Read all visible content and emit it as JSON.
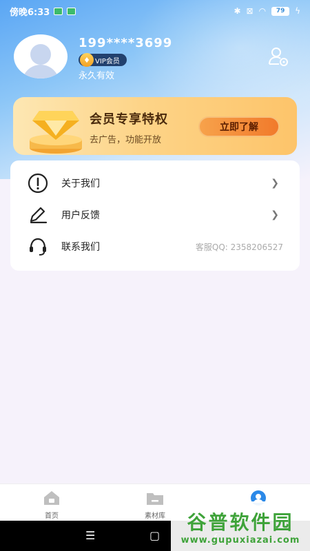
{
  "status_bar": {
    "time": "傍晚6:33",
    "battery": "79",
    "icons": [
      "bluetooth-icon",
      "sim-x-icon",
      "wifi-icon",
      "charging-icon"
    ]
  },
  "profile": {
    "phone": "199****3699",
    "vip_label": "VIP会员",
    "validity": "永久有效"
  },
  "vip_banner": {
    "title": "会员专享特权",
    "subtitle": "去广告，功能开放",
    "button": "立即了解"
  },
  "menu": {
    "items": [
      {
        "label": "关于我们",
        "icon": "info-circle-icon"
      },
      {
        "label": "用户反馈",
        "icon": "edit-pen-icon"
      },
      {
        "label": "联系我们",
        "icon": "headset-icon",
        "right_text": "客服QQ: 2358206527"
      }
    ]
  },
  "bottom_nav": {
    "tabs": [
      {
        "label": "首页",
        "icon": "home-icon"
      },
      {
        "label": "素材库",
        "icon": "folder-icon"
      },
      {
        "label": "",
        "icon": "profile-icon"
      }
    ],
    "active_color": "#2b89e8"
  },
  "watermark": {
    "title": "谷普软件园",
    "url": "www.gupuxiazai.com"
  }
}
